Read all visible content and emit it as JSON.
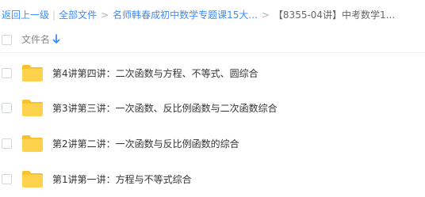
{
  "breadcrumb": {
    "back": "返回上一级",
    "all_files": "全部文件",
    "level2": "名师韩春成初中数学专题课15大...",
    "current": "【8355-04讲】中考数学1..."
  },
  "list_header": {
    "name_label": "文件名"
  },
  "files": [
    {
      "name": "第4讲第四讲：二次函数与方程、不等式、圆综合",
      "icon": "folder-icon"
    },
    {
      "name": "第3讲第三讲：一次函数、反比例函数与二次函数综合",
      "icon": "folder-icon"
    },
    {
      "name": "第2讲第二讲：一次函数与反比例函数的综合",
      "icon": "folder-icon"
    },
    {
      "name": "第1讲第一讲：方程与不等式综合",
      "icon": "folder-icon"
    }
  ],
  "colors": {
    "link": "#3b8cff",
    "folder": "#ffd24d",
    "folder_tab": "#f7c12f"
  }
}
